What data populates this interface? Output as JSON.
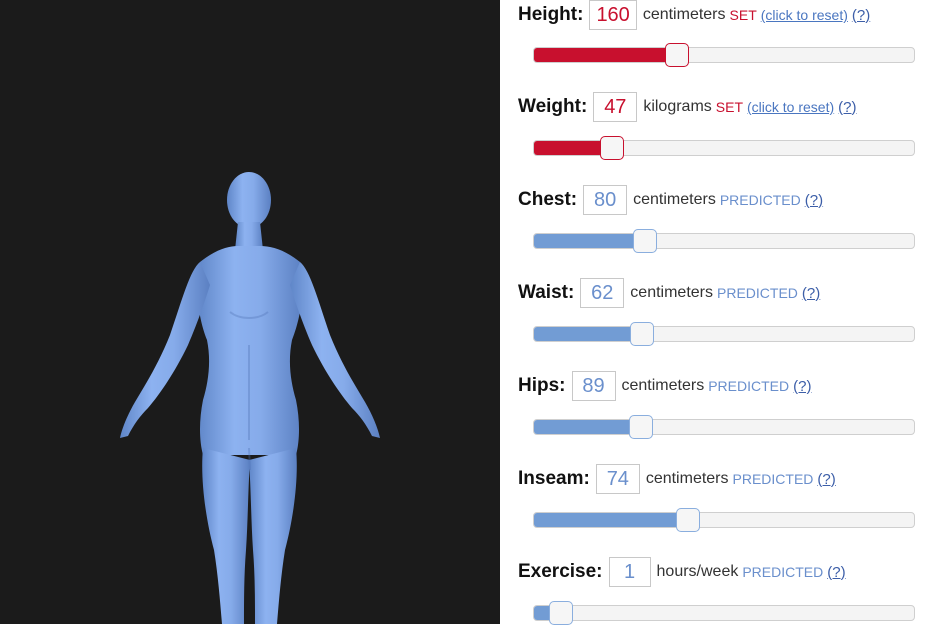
{
  "viewer": {
    "background": "#1b1b1b",
    "body_color": "#7ea6ea"
  },
  "measurements": [
    {
      "label": "Height:",
      "value": "160",
      "unit": "centimeters",
      "status": "SET",
      "reset": "(click to reset)",
      "help": "(?)",
      "fill": 0.375
    },
    {
      "label": "Weight:",
      "value": "47",
      "unit": "kilograms",
      "status": "SET",
      "reset": "(click to reset)",
      "help": "(?)",
      "fill": 0.205
    },
    {
      "label": "Chest:",
      "value": "80",
      "unit": "centimeters",
      "status": "PREDICTED",
      "help": "(?)",
      "fill": 0.292
    },
    {
      "label": "Waist:",
      "value": "62",
      "unit": "centimeters",
      "status": "PREDICTED",
      "help": "(?)",
      "fill": 0.285
    },
    {
      "label": "Hips:",
      "value": "89",
      "unit": "centimeters",
      "status": "PREDICTED",
      "help": "(?)",
      "fill": 0.281
    },
    {
      "label": "Inseam:",
      "value": "74",
      "unit": "centimeters",
      "status": "PREDICTED",
      "help": "(?)",
      "fill": 0.405
    },
    {
      "label": "Exercise:",
      "value": "1",
      "unit": "hours/week",
      "status": "PREDICTED",
      "help": "(?)",
      "fill": 0.07
    }
  ]
}
